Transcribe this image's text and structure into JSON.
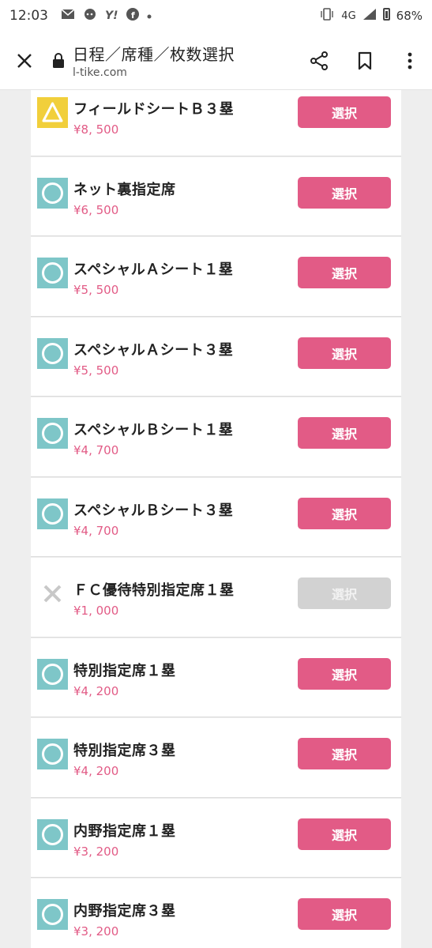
{
  "status_bar": {
    "time": "12:03",
    "network": "4G",
    "battery": "68%",
    "yahoo": "Y!"
  },
  "toolbar": {
    "title": "日程／席種／枚数選択",
    "url": "l-tike.com"
  },
  "seats": [
    {
      "name": "フィールドシートＢ３塁",
      "price": "¥8, 500",
      "availability": "triangle",
      "button": "選択",
      "enabled": true
    },
    {
      "name": "ネット裏指定席",
      "price": "¥6, 500",
      "availability": "circle",
      "button": "選択",
      "enabled": true
    },
    {
      "name": "スペシャルＡシート１塁",
      "price": "¥5, 500",
      "availability": "circle",
      "button": "選択",
      "enabled": true
    },
    {
      "name": "スペシャルＡシート３塁",
      "price": "¥5, 500",
      "availability": "circle",
      "button": "選択",
      "enabled": true
    },
    {
      "name": "スペシャルＢシート１塁",
      "price": "¥4, 700",
      "availability": "circle",
      "button": "選択",
      "enabled": true
    },
    {
      "name": "スペシャルＢシート３塁",
      "price": "¥4, 700",
      "availability": "circle",
      "button": "選択",
      "enabled": true
    },
    {
      "name": "ＦＣ優待特別指定席１塁",
      "price": "¥1, 000",
      "availability": "cross",
      "button": "選択",
      "enabled": false
    },
    {
      "name": "特別指定席１塁",
      "price": "¥4, 200",
      "availability": "circle",
      "button": "選択",
      "enabled": true
    },
    {
      "name": "特別指定席３塁",
      "price": "¥4, 200",
      "availability": "circle",
      "button": "選択",
      "enabled": true
    },
    {
      "name": "内野指定席１塁",
      "price": "¥3, 200",
      "availability": "circle",
      "button": "選択",
      "enabled": true
    },
    {
      "name": "内野指定席３塁",
      "price": "¥3, 200",
      "availability": "circle",
      "button": "選択",
      "enabled": true
    }
  ],
  "colors": {
    "accent": "#e25b86",
    "available": "#7ec6c8",
    "few_left": "#f1cf3b",
    "disabled": "#d2d2d2"
  }
}
